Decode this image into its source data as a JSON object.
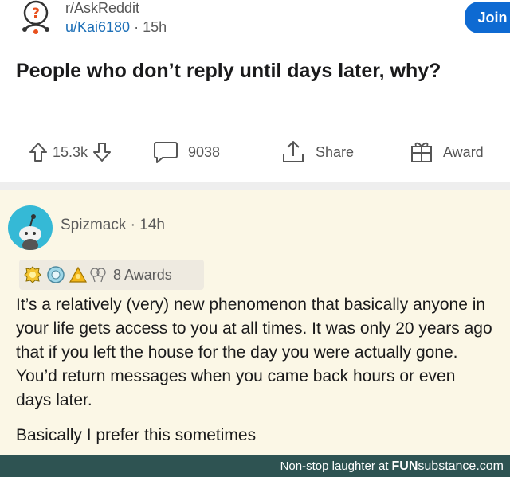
{
  "post": {
    "subreddit": "r/AskReddit",
    "user": "u/Kai6180",
    "time": "15h",
    "join_label": "Join",
    "title": "People who don’t reply until days later, why?",
    "upvotes": "15.3k",
    "comments": "9038",
    "share_label": "Share",
    "award_label": "Award",
    "icons": {
      "subreddit": "askreddit-question-icon",
      "upvote": "arrow-up-icon",
      "downvote": "arrow-down-icon",
      "comments": "comment-bubble-icon",
      "share": "share-icon",
      "award": "gift-icon"
    },
    "colors": {
      "join_bg": "#0e6ad2",
      "user_link": "#1c6fb7"
    }
  },
  "comment": {
    "author": "Spizmack",
    "time": "14h",
    "awards_label": "8 Awards",
    "award_icons": [
      "wholesome-award-icon",
      "platinum-award-icon",
      "gold-award-icon",
      "silver-award-icon"
    ],
    "paragraphs": [
      "It’s a relatively (very) new phenomenon that basically anyone in your life gets access to you at all times. It was only 20 years ago that if you left the house for the day you were actually gone. You’d return messages when you came back hours or even days later.",
      "Basically I prefer this sometimes"
    ],
    "colors": {
      "background": "#fbf7e6",
      "avatar": "#35b9d6"
    }
  },
  "footer": {
    "text": "Non-stop laughter at",
    "brand_prefix": "FUN",
    "brand_suffix": "substance.com",
    "background": "#2e5352"
  }
}
